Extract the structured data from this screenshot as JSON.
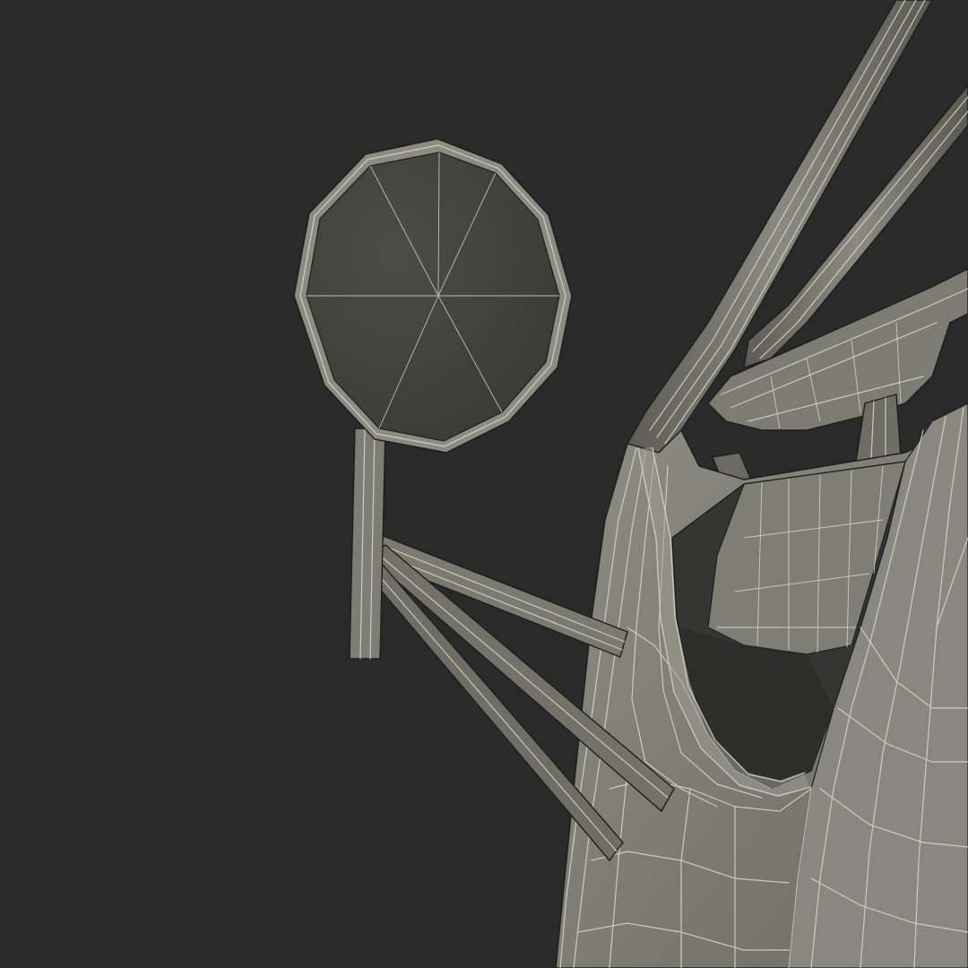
{
  "scene": {
    "background_color": "#2a2a2a",
    "model_colors": {
      "surface_light": "#8a8a7f",
      "surface_mid": "#6f6f66",
      "surface_dark": "#4c4c46",
      "interior_shadow": "#333331",
      "wireframe": "#d9d9c8"
    }
  }
}
